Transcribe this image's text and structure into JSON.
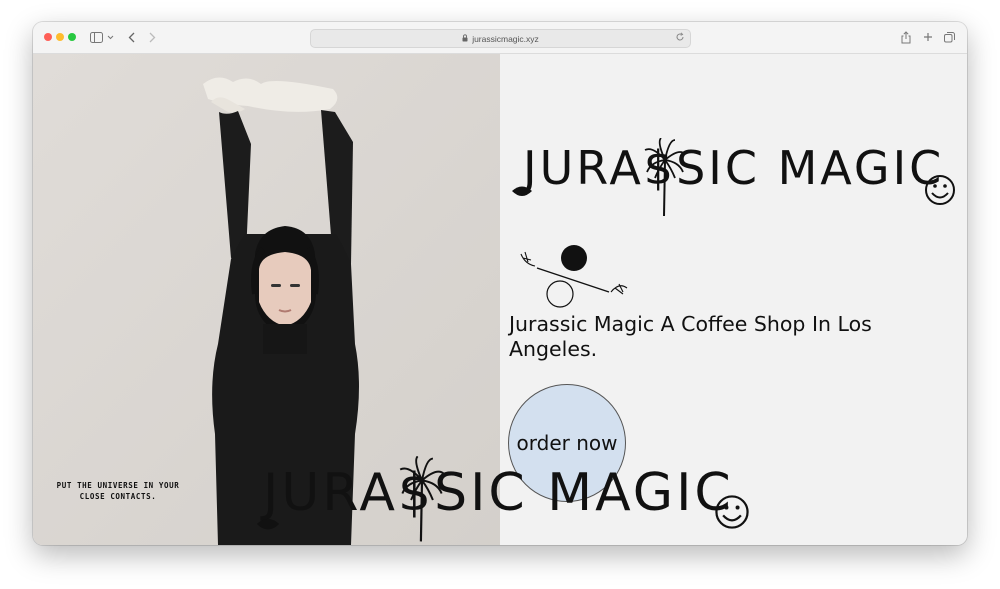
{
  "browser": {
    "url": "jurassicmagic.xyz"
  },
  "brand": {
    "logo_text": "JURA$SIC MAGIC"
  },
  "hero": {
    "tagline": "Jurassic Magic A Coffee Shop In Los Angeles.",
    "order_button": "order now",
    "caption": "PUT THE UNIVERSE IN YOUR CLOSE CONTACTS."
  },
  "colors": {
    "page_background": "#f2f2f2",
    "order_button_fill": "#d3e0ef",
    "text": "#111111"
  },
  "icons": [
    "sidebar-icon",
    "chevron-down-icon",
    "back-icon",
    "forward-icon",
    "lock-icon",
    "reload-icon",
    "share-icon",
    "new-tab-icon",
    "tabs-overview-icon",
    "palm-tree-icon",
    "smiley-icon",
    "lips-icon"
  ]
}
